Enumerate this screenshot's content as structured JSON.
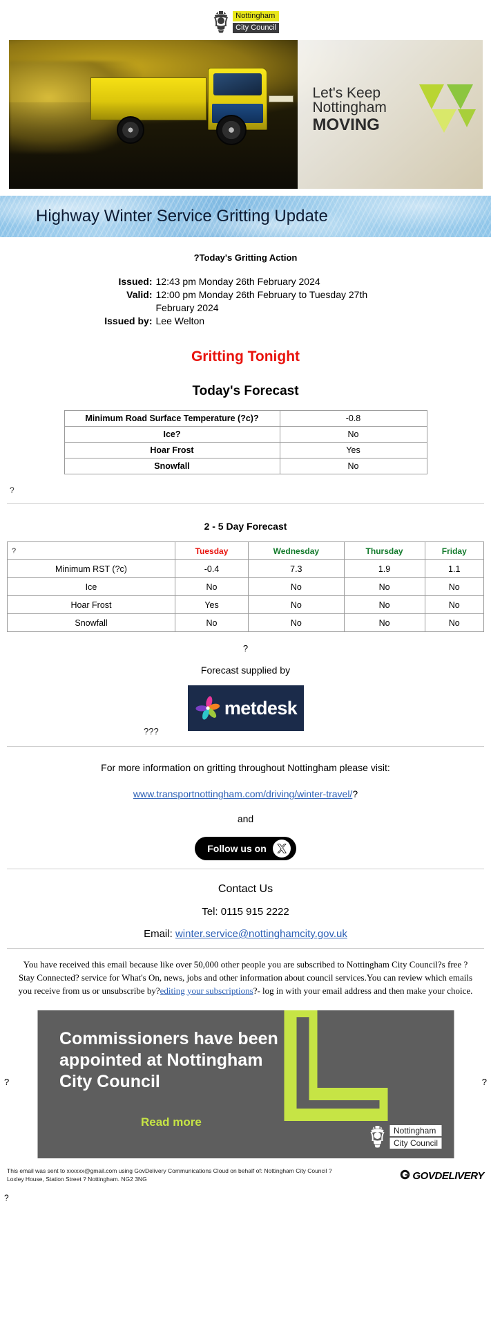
{
  "header": {
    "logo_line1": "Nottingham",
    "logo_line2": "City Council",
    "crest_icon": "nottingham-crest-icon"
  },
  "hero": {
    "banner_line1": "Let's Keep",
    "banner_line2": "Nottingham",
    "banner_line3": "MOVING",
    "truck_plate": "",
    "alt": "yellow gritter lorry inside salt barn"
  },
  "title_band": {
    "title": "Highway Winter Service Gritting Update"
  },
  "gritting_action": {
    "heading": "?Today's Gritting Action",
    "rows": [
      {
        "label": "Issued:",
        "value": "12:43 pm Monday 26th February 2024"
      },
      {
        "label": "Valid:",
        "value": "12:00 pm Monday 26th February to Tuesday 27th February 2024"
      },
      {
        "label": "Issued by:",
        "value": "Lee Welton"
      }
    ],
    "alert": "Gritting Tonight",
    "alert_color": "#e8120c"
  },
  "today_forecast": {
    "title": "Today's Forecast",
    "rows": [
      {
        "key": "Minimum Road Surface Temperature (?c)?",
        "value": "-0.8"
      },
      {
        "key": "Ice?",
        "value": "No"
      },
      {
        "key": "Hoar Frost",
        "value": "Yes"
      },
      {
        "key": "Snowfall",
        "value": "No"
      }
    ],
    "stray_char": "?"
  },
  "five_day": {
    "title": "2 - 5 Day Forecast",
    "corner": "?",
    "days": [
      {
        "label": "Tuesday",
        "color": "#e8120c"
      },
      {
        "label": "Wednesday",
        "color": "#127a2b"
      },
      {
        "label": "Thursday",
        "color": "#127a2b"
      },
      {
        "label": "Friday",
        "color": "#127a2b"
      }
    ],
    "rows": [
      {
        "label": "Minimum RST (?c)",
        "values": [
          "-0.4",
          "7.3",
          "1.9",
          "1.1"
        ]
      },
      {
        "label": "Ice",
        "values": [
          "No",
          "No",
          "No",
          "No"
        ]
      },
      {
        "label": "Hoar Frost",
        "values": [
          "Yes",
          "No",
          "No",
          "No"
        ]
      },
      {
        "label": "Snowfall",
        "values": [
          "No",
          "No",
          "No",
          "No"
        ]
      }
    ],
    "after_table_char": "?"
  },
  "supplier": {
    "caption": "Forecast supplied by",
    "logo_word": "metdesk",
    "logo_bg": "#1b2b4a",
    "stray_chars": "???"
  },
  "links": {
    "info_text": "For more information on gritting throughout Nottingham please visit:",
    "url_text": "www.transportnottingham.com/driving/winter-travel/",
    "url_suffix": "?",
    "and_text": "and",
    "social_label": "Follow us on",
    "social_icon": "x-twitter-icon"
  },
  "contact": {
    "title": "Contact Us",
    "tel": "Tel: 0115 915 2222",
    "email_label": "Email:",
    "email": "winter.service@nottinghamcity.gov.uk"
  },
  "disclaimer": {
    "part1": "You have received this email because like over 50,000 other people you are subscribed to Nottingham City Council?s free ?Stay Connected? service for What's On, news, jobs and other information about council services.You can review which emails you receive from us or unsubscribe by?",
    "link": "editing your subscriptions",
    "part2": "?- log in with your email address and then make your choice."
  },
  "commissioners": {
    "line1": "Commissioners have been",
    "line2": "appointed at Nottingham",
    "line3": "City Council",
    "cta": "Read more",
    "logo_line1": "Nottingham",
    "logo_line2": "City Council",
    "left_char": "?",
    "right_char": "?"
  },
  "footer": {
    "line1": "This email was sent to xxxxxx@gmail.com using GovDelivery Communications Cloud on behalf of: Nottingham City Council ?",
    "line2": "Loxley House, Station Street ? Nottingham. NG2 3NG",
    "govdelivery": "GOVDELIVERY",
    "tail_char": "?"
  }
}
